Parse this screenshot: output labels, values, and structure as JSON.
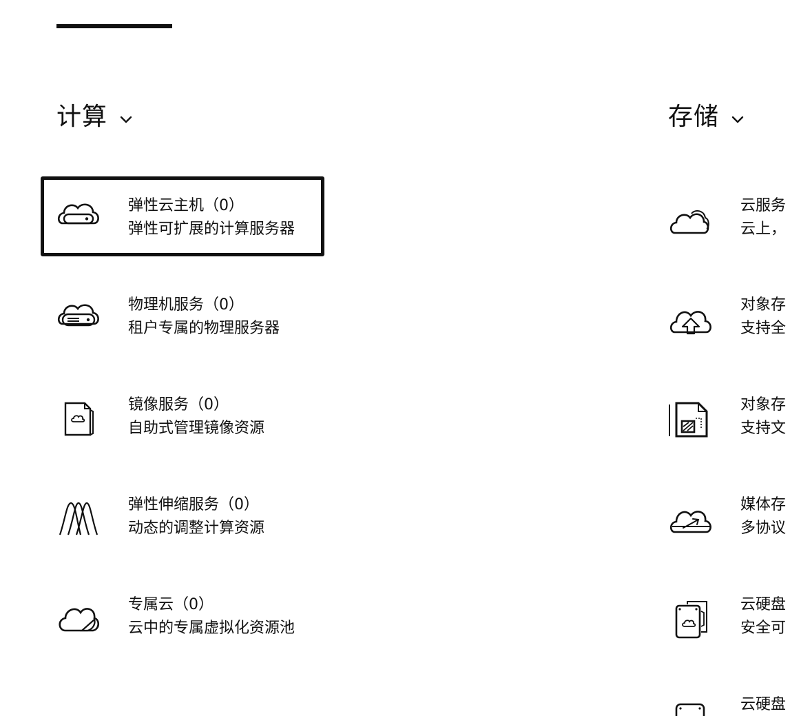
{
  "sections": {
    "compute": {
      "title": "计算",
      "items": [
        {
          "name": "弹性云主机（0）",
          "desc": "弹性可扩展的计算服务器",
          "icon": "cloud-server-icon",
          "selected": true
        },
        {
          "name": "物理机服务（0）",
          "desc": "租户专属的物理服务器",
          "icon": "cloud-hardware-icon"
        },
        {
          "name": "镜像服务（0）",
          "desc": "自助式管理镜像资源",
          "icon": "image-file-icon"
        },
        {
          "name": "弹性伸缩服务（0）",
          "desc": "动态的调整计算资源",
          "icon": "scaling-waves-icon"
        },
        {
          "name": "专属云（0）",
          "desc": "云中的专属虚拟化资源池",
          "icon": "dedicated-cloud-icon"
        }
      ]
    },
    "storage": {
      "title": "存储",
      "items": [
        {
          "name": "云服务",
          "desc": "云上，",
          "icon": "double-cloud-icon"
        },
        {
          "name": "对象存",
          "desc": "支持全",
          "icon": "cloud-upload-icon"
        },
        {
          "name": "对象存",
          "desc": "支持文",
          "icon": "object-file-icon"
        },
        {
          "name": "媒体存",
          "desc": "多协议",
          "icon": "cloud-transfer-icon"
        },
        {
          "name": "云硬盘",
          "desc": "安全可",
          "icon": "disk-stack-icon"
        },
        {
          "name": "云硬盘",
          "desc": "",
          "icon": "disk-icon"
        }
      ]
    }
  }
}
